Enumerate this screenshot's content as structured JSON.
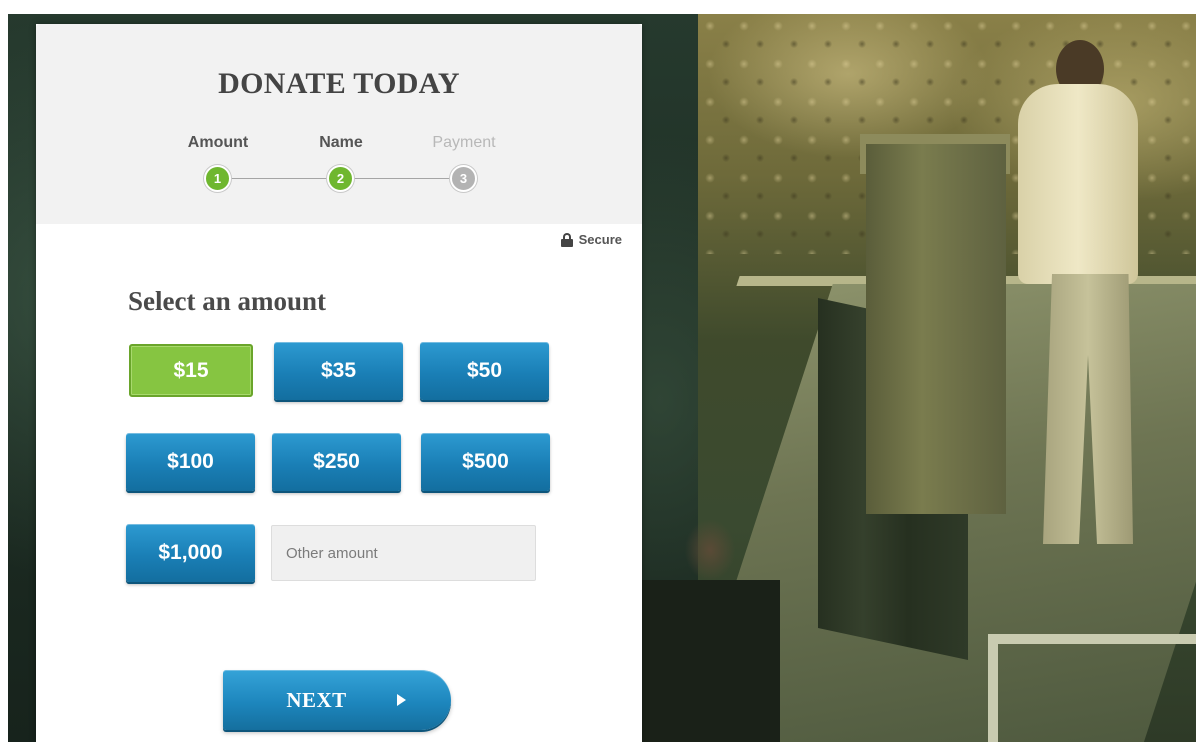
{
  "form": {
    "title": "DONATE TODAY",
    "secure_label": "Secure",
    "section_title": "Select an amount",
    "steps": [
      {
        "label": "Amount",
        "number": "1",
        "state": "done"
      },
      {
        "label": "Name",
        "number": "2",
        "state": "done"
      },
      {
        "label": "Payment",
        "number": "3",
        "state": "todo"
      }
    ],
    "amounts": [
      {
        "label": "$15",
        "selected": true
      },
      {
        "label": "$35",
        "selected": false
      },
      {
        "label": "$50",
        "selected": false
      },
      {
        "label": "$100",
        "selected": false
      },
      {
        "label": "$250",
        "selected": false
      },
      {
        "label": "$500",
        "selected": false
      },
      {
        "label": "$1,000",
        "selected": false
      }
    ],
    "other_amount": {
      "value": "",
      "placeholder": "Other amount"
    },
    "next_label": "NEXT"
  },
  "icons": {
    "secure": "lock-icon",
    "next": "play-icon"
  },
  "colors": {
    "selected_amount": "#86c541",
    "amount_button": "#1a7fb6",
    "step_done": "#6fb72f",
    "step_todo": "#b3b3b3"
  }
}
